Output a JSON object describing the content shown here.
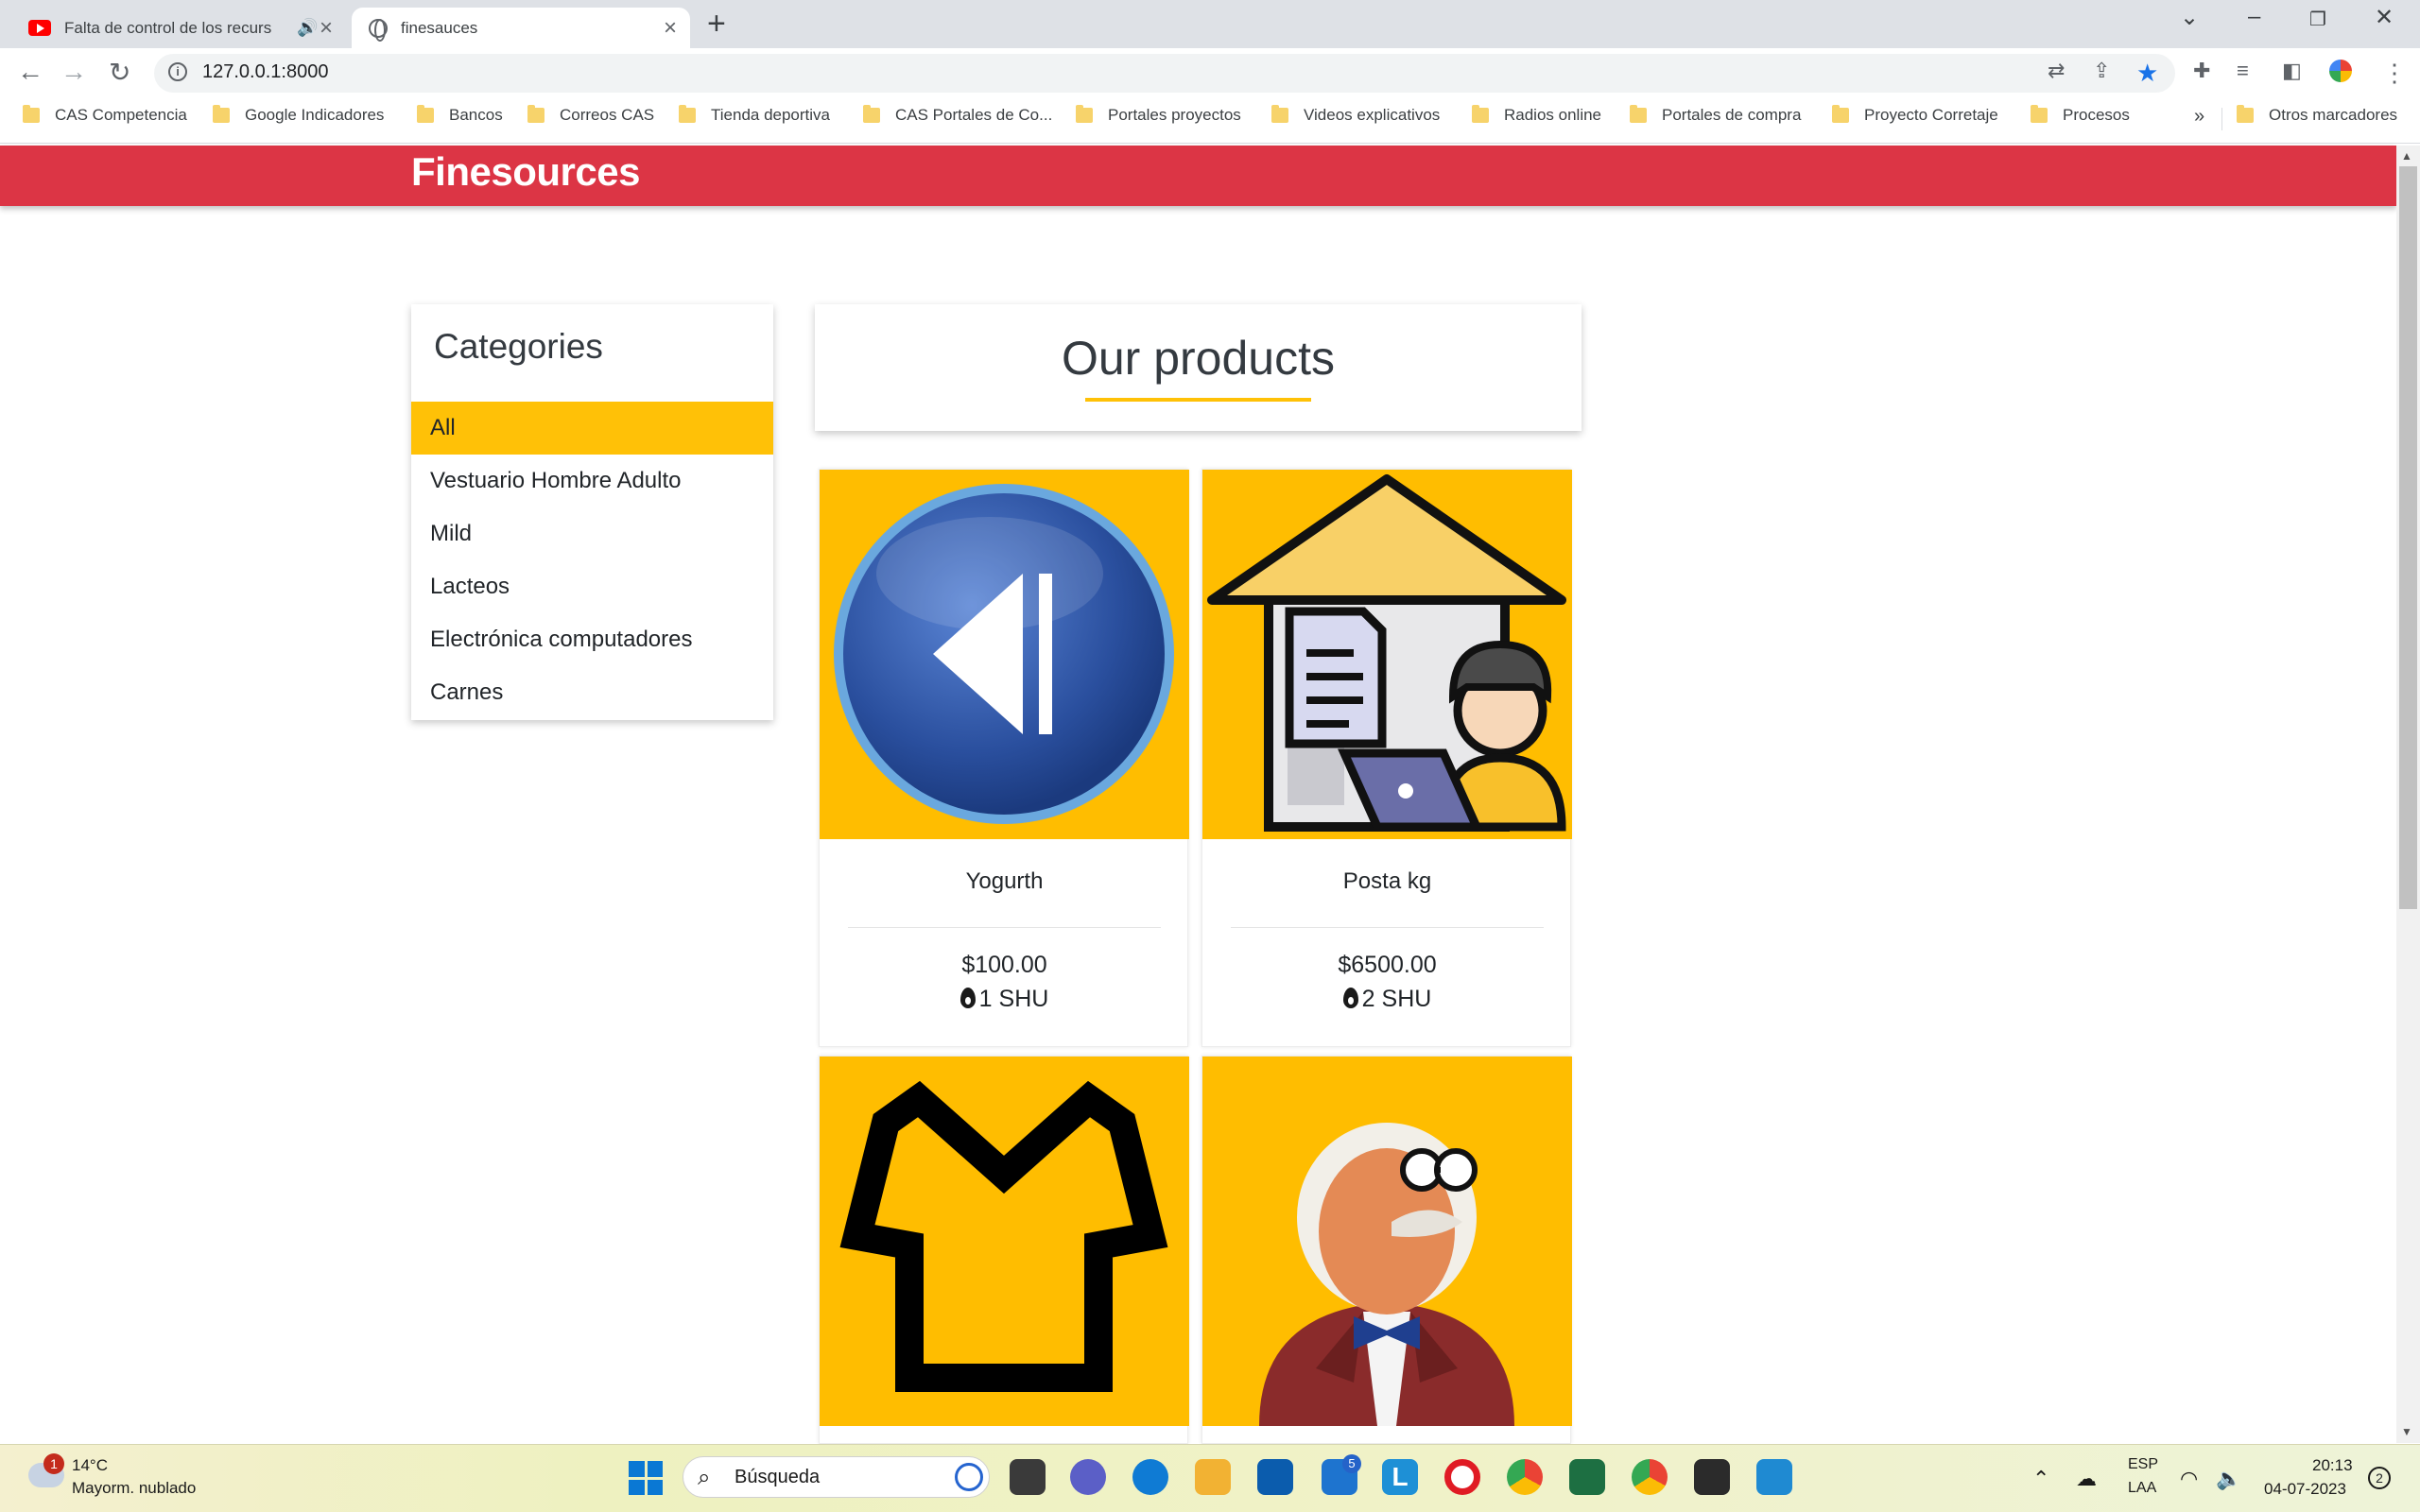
{
  "browser": {
    "tabs": [
      {
        "title": "Falta de control de los recurs",
        "icon": "youtube-icon",
        "active": false
      },
      {
        "title": "finesauces",
        "icon": "globe-icon",
        "active": true
      }
    ],
    "url": "127.0.0.1:8000",
    "bookmarks": [
      "CAS Competencia",
      "Google Indicadores",
      "Bancos",
      "Correos CAS",
      "Tienda deportiva",
      "CAS Portales de Co...",
      "Portales proyectos",
      "Videos explicativos",
      "Radios online",
      "Portales de compra",
      "Proyecto Corretaje",
      "Procesos"
    ],
    "bookmarks_overflow": "»",
    "other_bookmarks": "Otros marcadores"
  },
  "site": {
    "brand": "Finesources",
    "categories_title": "Categories",
    "categories": [
      "All",
      "Vestuario Hombre Adulto",
      "Mild",
      "Lacteos",
      "Electrónica computadores",
      "Carnes"
    ],
    "active_category": "All",
    "products_title": "Our products",
    "products": [
      {
        "name": "Yogurth",
        "price": "$100.00",
        "shu": "1 SHU",
        "image": "back-button-image"
      },
      {
        "name": "Posta kg",
        "price": "$6500.00",
        "shu": "2 SHU",
        "image": "remote-work-image"
      },
      {
        "image": "tshirt-image"
      },
      {
        "image": "scientist-image"
      }
    ],
    "colors": {
      "navbar": "#dc3545",
      "accent": "#ffc107",
      "product_bg": "#ffbd00"
    }
  },
  "taskbar": {
    "weather_temp": "14°C",
    "weather_desc": "Mayorm. nublado",
    "weather_badge": "1",
    "search_placeholder": "Búsqueda",
    "mail_badge": "5",
    "lang_1": "ESP",
    "lang_2": "LAA",
    "time": "20:13",
    "date": "04-07-2023",
    "notifications": "2"
  }
}
